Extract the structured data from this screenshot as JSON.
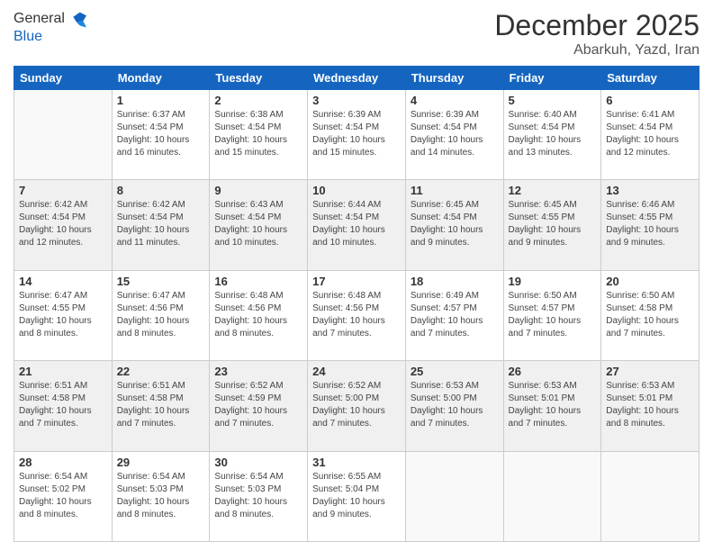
{
  "logo": {
    "line1": "General",
    "line2": "Blue"
  },
  "header": {
    "month": "December 2025",
    "location": "Abarkuh, Yazd, Iran"
  },
  "weekdays": [
    "Sunday",
    "Monday",
    "Tuesday",
    "Wednesday",
    "Thursday",
    "Friday",
    "Saturday"
  ],
  "weeks": [
    [
      {
        "day": "",
        "info": ""
      },
      {
        "day": "1",
        "info": "Sunrise: 6:37 AM\nSunset: 4:54 PM\nDaylight: 10 hours\nand 16 minutes."
      },
      {
        "day": "2",
        "info": "Sunrise: 6:38 AM\nSunset: 4:54 PM\nDaylight: 10 hours\nand 15 minutes."
      },
      {
        "day": "3",
        "info": "Sunrise: 6:39 AM\nSunset: 4:54 PM\nDaylight: 10 hours\nand 15 minutes."
      },
      {
        "day": "4",
        "info": "Sunrise: 6:39 AM\nSunset: 4:54 PM\nDaylight: 10 hours\nand 14 minutes."
      },
      {
        "day": "5",
        "info": "Sunrise: 6:40 AM\nSunset: 4:54 PM\nDaylight: 10 hours\nand 13 minutes."
      },
      {
        "day": "6",
        "info": "Sunrise: 6:41 AM\nSunset: 4:54 PM\nDaylight: 10 hours\nand 12 minutes."
      }
    ],
    [
      {
        "day": "7",
        "info": "Sunrise: 6:42 AM\nSunset: 4:54 PM\nDaylight: 10 hours\nand 12 minutes."
      },
      {
        "day": "8",
        "info": "Sunrise: 6:42 AM\nSunset: 4:54 PM\nDaylight: 10 hours\nand 11 minutes."
      },
      {
        "day": "9",
        "info": "Sunrise: 6:43 AM\nSunset: 4:54 PM\nDaylight: 10 hours\nand 10 minutes."
      },
      {
        "day": "10",
        "info": "Sunrise: 6:44 AM\nSunset: 4:54 PM\nDaylight: 10 hours\nand 10 minutes."
      },
      {
        "day": "11",
        "info": "Sunrise: 6:45 AM\nSunset: 4:54 PM\nDaylight: 10 hours\nand 9 minutes."
      },
      {
        "day": "12",
        "info": "Sunrise: 6:45 AM\nSunset: 4:55 PM\nDaylight: 10 hours\nand 9 minutes."
      },
      {
        "day": "13",
        "info": "Sunrise: 6:46 AM\nSunset: 4:55 PM\nDaylight: 10 hours\nand 9 minutes."
      }
    ],
    [
      {
        "day": "14",
        "info": "Sunrise: 6:47 AM\nSunset: 4:55 PM\nDaylight: 10 hours\nand 8 minutes."
      },
      {
        "day": "15",
        "info": "Sunrise: 6:47 AM\nSunset: 4:56 PM\nDaylight: 10 hours\nand 8 minutes."
      },
      {
        "day": "16",
        "info": "Sunrise: 6:48 AM\nSunset: 4:56 PM\nDaylight: 10 hours\nand 8 minutes."
      },
      {
        "day": "17",
        "info": "Sunrise: 6:48 AM\nSunset: 4:56 PM\nDaylight: 10 hours\nand 7 minutes."
      },
      {
        "day": "18",
        "info": "Sunrise: 6:49 AM\nSunset: 4:57 PM\nDaylight: 10 hours\nand 7 minutes."
      },
      {
        "day": "19",
        "info": "Sunrise: 6:50 AM\nSunset: 4:57 PM\nDaylight: 10 hours\nand 7 minutes."
      },
      {
        "day": "20",
        "info": "Sunrise: 6:50 AM\nSunset: 4:58 PM\nDaylight: 10 hours\nand 7 minutes."
      }
    ],
    [
      {
        "day": "21",
        "info": "Sunrise: 6:51 AM\nSunset: 4:58 PM\nDaylight: 10 hours\nand 7 minutes."
      },
      {
        "day": "22",
        "info": "Sunrise: 6:51 AM\nSunset: 4:58 PM\nDaylight: 10 hours\nand 7 minutes."
      },
      {
        "day": "23",
        "info": "Sunrise: 6:52 AM\nSunset: 4:59 PM\nDaylight: 10 hours\nand 7 minutes."
      },
      {
        "day": "24",
        "info": "Sunrise: 6:52 AM\nSunset: 5:00 PM\nDaylight: 10 hours\nand 7 minutes."
      },
      {
        "day": "25",
        "info": "Sunrise: 6:53 AM\nSunset: 5:00 PM\nDaylight: 10 hours\nand 7 minutes."
      },
      {
        "day": "26",
        "info": "Sunrise: 6:53 AM\nSunset: 5:01 PM\nDaylight: 10 hours\nand 7 minutes."
      },
      {
        "day": "27",
        "info": "Sunrise: 6:53 AM\nSunset: 5:01 PM\nDaylight: 10 hours\nand 8 minutes."
      }
    ],
    [
      {
        "day": "28",
        "info": "Sunrise: 6:54 AM\nSunset: 5:02 PM\nDaylight: 10 hours\nand 8 minutes."
      },
      {
        "day": "29",
        "info": "Sunrise: 6:54 AM\nSunset: 5:03 PM\nDaylight: 10 hours\nand 8 minutes."
      },
      {
        "day": "30",
        "info": "Sunrise: 6:54 AM\nSunset: 5:03 PM\nDaylight: 10 hours\nand 8 minutes."
      },
      {
        "day": "31",
        "info": "Sunrise: 6:55 AM\nSunset: 5:04 PM\nDaylight: 10 hours\nand 9 minutes."
      },
      {
        "day": "",
        "info": ""
      },
      {
        "day": "",
        "info": ""
      },
      {
        "day": "",
        "info": ""
      }
    ]
  ]
}
